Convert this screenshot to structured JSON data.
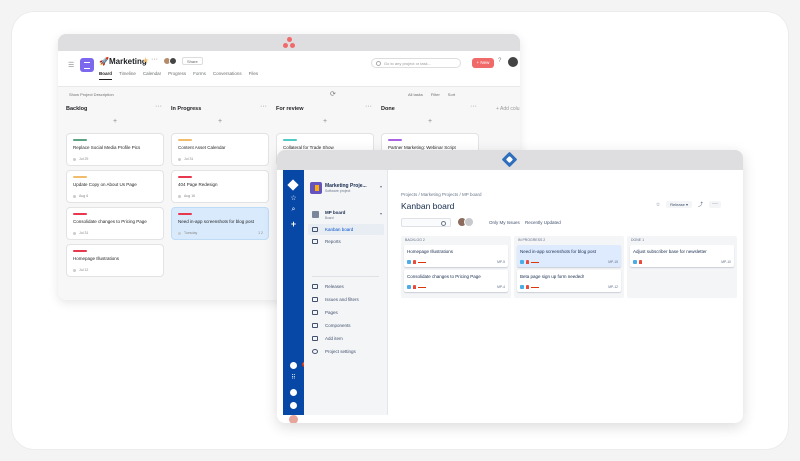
{
  "asana": {
    "title": "Marketing",
    "project_emoji": "🚀",
    "share": "Share",
    "tabs": [
      "Board",
      "Timeline",
      "Calendar",
      "Progress",
      "Forms",
      "Conversations",
      "Files"
    ],
    "search_placeholder": "Go to any project or task...",
    "new_button": "+ New",
    "show_description": "Show Project Description",
    "toolbar": [
      "All tasks",
      "Filter",
      "Sort"
    ],
    "add_column": "+ Add colu",
    "columns": [
      {
        "name": "Backlog",
        "cards": [
          {
            "name": "Replace Social Media Profile Pics",
            "date": "Jul 29",
            "bar": "#5da283"
          },
          {
            "name": "Update Copy on About Us Page",
            "date": "Aug 6",
            "bar": "#f1bd6c"
          },
          {
            "name": "Consolidate changes to Pricing Page",
            "date": "Jul 31",
            "bar": "#e8384f"
          },
          {
            "name": "Homepage Illustrations",
            "date": "Jul 12",
            "bar": "#e8384f"
          }
        ]
      },
      {
        "name": "In Progress",
        "cards": [
          {
            "name": "Content Asset Calendar",
            "date": "Jul 31",
            "bar": "#f1bd6c"
          },
          {
            "name": "404 Page Redesign",
            "date": "Aug 16",
            "bar": "#e8384f"
          },
          {
            "name": "Need in-app screenshots for blog post",
            "date": "Tuesday",
            "bar": "#e8384f",
            "sub": "1 2",
            "selected": true
          }
        ]
      },
      {
        "name": "For review",
        "cards": [
          {
            "name": "Collateral for Trade Show",
            "date": "Tomorrow",
            "bar": "#4ecbc4"
          }
        ]
      },
      {
        "name": "Done",
        "cards": [
          {
            "name": "Partner Marketing: Webinar Script",
            "date": "Yesterday",
            "bar": "#aa62e3"
          }
        ]
      }
    ],
    "colors": {
      "accent": "#f06a6a",
      "project_icon": "#7b68ee"
    }
  },
  "jira": {
    "project_name": "Marketing Proje...",
    "project_sub": "Software project",
    "board_name": "MP board",
    "board_sub": "Board",
    "nav": [
      "Kanban board",
      "Reports",
      "Releases",
      "Issues and filters",
      "Pages",
      "Components",
      "Add item",
      "Project settings"
    ],
    "notification_count": "9",
    "breadcrumb": "Projects  /  Marketing Projects  /  MP board",
    "title": "Kanban board",
    "release_button": "Release",
    "quick_filters": [
      "Only My Issues",
      "Recently Updated"
    ],
    "columns": [
      {
        "name": "BACKLOG 2",
        "cards": [
          {
            "name": "Homepage Illustrations",
            "key": "MP-5"
          },
          {
            "name": "Consolidate changes to Pricing Page",
            "key": "MP-4"
          }
        ]
      },
      {
        "name": "IN PROGRESS 2",
        "cards": [
          {
            "name": "Need in-app screenshots for blog post",
            "key": "MP-15",
            "selected": true
          },
          {
            "name": "Beta page sign up form needed!",
            "key": "MP-12"
          }
        ]
      },
      {
        "name": "DONE 1",
        "cards": [
          {
            "name": "Adjust subscriber base for newsletter",
            "key": "MP-10"
          }
        ]
      }
    ],
    "colors": {
      "rail": "#0747a6",
      "selected_card": "#deebff"
    }
  }
}
